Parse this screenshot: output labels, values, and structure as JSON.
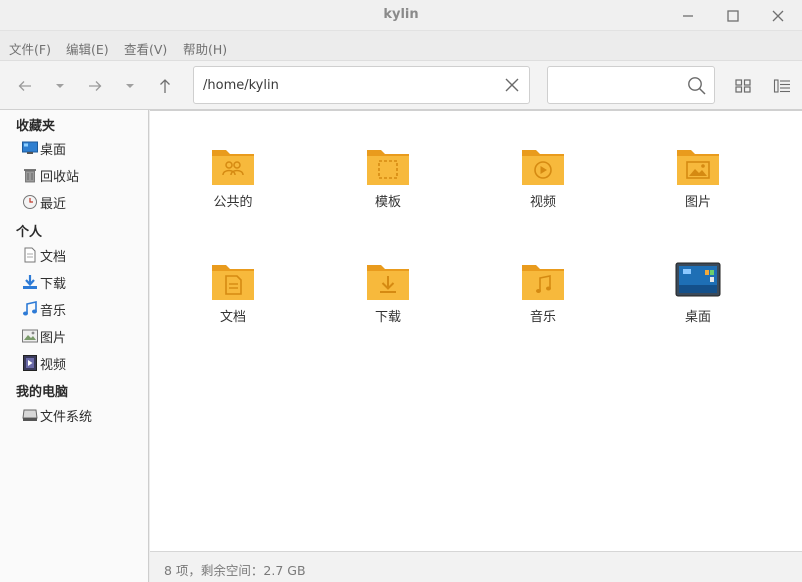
{
  "window": {
    "title": "kylin"
  },
  "menu": [
    "文件(F)",
    "编辑(E)",
    "查看(V)",
    "帮助(H)"
  ],
  "toolbar": {
    "path": "/home/kylin",
    "search_value": ""
  },
  "sidebar": {
    "sections": [
      {
        "heading": "收藏夹",
        "items": [
          {
            "label": "桌面",
            "icon": "desktop-icon"
          },
          {
            "label": "回收站",
            "icon": "trash-icon"
          },
          {
            "label": "最近",
            "icon": "clock-icon"
          }
        ]
      },
      {
        "heading": "个人",
        "items": [
          {
            "label": "文档",
            "icon": "document-icon"
          },
          {
            "label": "下载",
            "icon": "download-icon"
          },
          {
            "label": "音乐",
            "icon": "music-icon"
          },
          {
            "label": "图片",
            "icon": "picture-icon"
          },
          {
            "label": "视频",
            "icon": "video-icon"
          }
        ]
      },
      {
        "heading": "我的电脑",
        "items": [
          {
            "label": "文件系统",
            "icon": "drive-icon"
          }
        ]
      }
    ]
  },
  "files": [
    {
      "label": "公共的",
      "icon": "folder-public-icon"
    },
    {
      "label": "模板",
      "icon": "folder-templates-icon"
    },
    {
      "label": "视频",
      "icon": "folder-videos-icon"
    },
    {
      "label": "图片",
      "icon": "folder-pictures-icon"
    },
    {
      "label": "文档",
      "icon": "folder-documents-icon"
    },
    {
      "label": "下载",
      "icon": "folder-downloads-icon"
    },
    {
      "label": "音乐",
      "icon": "folder-music-icon"
    },
    {
      "label": "桌面",
      "icon": "folder-desktop-icon"
    }
  ],
  "status": {
    "text": "8 项，剩余空间：2.7 GB"
  },
  "colors": {
    "folder": "#f7b93c",
    "folder_dark": "#e99b1d",
    "accent": "#3a8ee6"
  }
}
